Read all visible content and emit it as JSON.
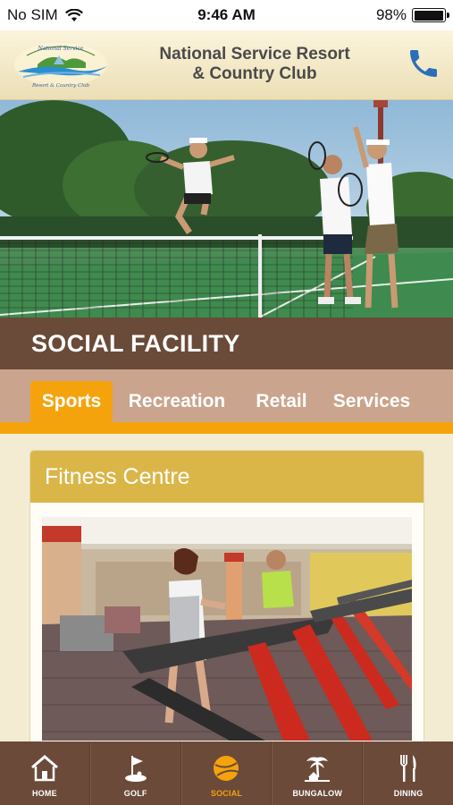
{
  "status_bar": {
    "carrier": "No SIM",
    "time": "9:46 AM",
    "battery_percent": "98%",
    "battery_level": 0.98
  },
  "header": {
    "title_line1": "National Service Resort",
    "title_line2": "& Country Club",
    "phone_icon": "phone-icon"
  },
  "section": {
    "title": "SOCIAL FACILITY"
  },
  "tabs": [
    {
      "label": "Sports",
      "active": true
    },
    {
      "label": "Recreation",
      "active": false
    },
    {
      "label": "Retail",
      "active": false
    },
    {
      "label": "Services",
      "active": false
    }
  ],
  "card": {
    "title": "Fitness Centre"
  },
  "bottom_nav": [
    {
      "label": "HOME",
      "icon": "home-icon",
      "active": false
    },
    {
      "label": "GOLF",
      "icon": "golf-flag-icon",
      "active": false
    },
    {
      "label": "SOCIAL",
      "icon": "social-ball-icon",
      "active": true
    },
    {
      "label": "BUNGALOW",
      "icon": "bungalow-palm-icon",
      "active": false
    },
    {
      "label": "DINING",
      "icon": "fork-knife-icon",
      "active": false
    }
  ],
  "colors": {
    "accent": "#f5a30c",
    "brown": "#6a4a38",
    "tab_bar": "#caa48c",
    "card_header": "#dab649",
    "phone_blue": "#2a6fb8"
  }
}
